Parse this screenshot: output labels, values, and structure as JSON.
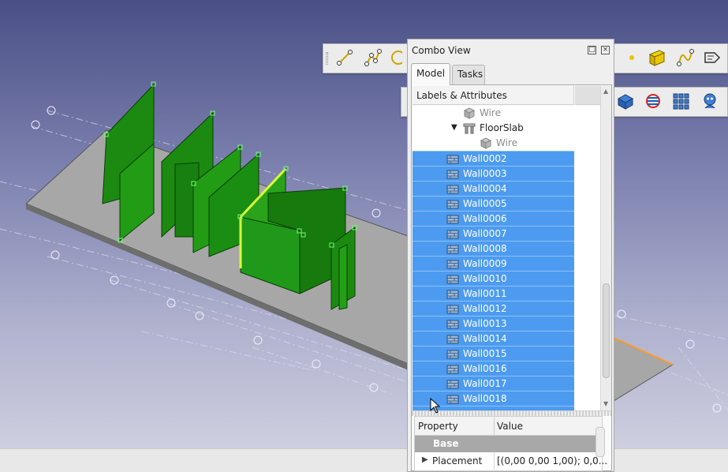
{
  "combo_view": {
    "title": "Combo View",
    "tabs": [
      {
        "label": "Model",
        "active": true
      },
      {
        "label": "Tasks",
        "active": false
      }
    ]
  },
  "tree": {
    "header": "Labels & Attributes",
    "rows": [
      {
        "label": "Wire",
        "type": "wire",
        "selected": false,
        "dim": true
      },
      {
        "label": "FloorSlab",
        "type": "structure",
        "selected": false,
        "dim": false,
        "expanded": true
      },
      {
        "label": "Wire",
        "type": "wire",
        "selected": false,
        "dim": true
      },
      {
        "label": "Wall0002",
        "type": "wall",
        "selected": true
      },
      {
        "label": "Wall0003",
        "type": "wall",
        "selected": true
      },
      {
        "label": "Wall0004",
        "type": "wall",
        "selected": true
      },
      {
        "label": "Wall0005",
        "type": "wall",
        "selected": true
      },
      {
        "label": "Wall0006",
        "type": "wall",
        "selected": true
      },
      {
        "label": "Wall0007",
        "type": "wall",
        "selected": true
      },
      {
        "label": "Wall0008",
        "type": "wall",
        "selected": true
      },
      {
        "label": "Wall0009",
        "type": "wall",
        "selected": true
      },
      {
        "label": "Wall0010",
        "type": "wall",
        "selected": true
      },
      {
        "label": "Wall0011",
        "type": "wall",
        "selected": true
      },
      {
        "label": "Wall0012",
        "type": "wall",
        "selected": true
      },
      {
        "label": "Wall0013",
        "type": "wall",
        "selected": true
      },
      {
        "label": "Wall0014",
        "type": "wall",
        "selected": true
      },
      {
        "label": "Wall0015",
        "type": "wall",
        "selected": true
      },
      {
        "label": "Wall0016",
        "type": "wall",
        "selected": true
      },
      {
        "label": "Wall0017",
        "type": "wall",
        "selected": true
      },
      {
        "label": "Wall0018",
        "type": "wall",
        "selected": true
      }
    ]
  },
  "properties": {
    "col_property": "Property",
    "col_value": "Value",
    "group": "Base",
    "rows": [
      {
        "name": "Placement",
        "value": "[(0,00 0,00 1,00); 0,0..."
      }
    ]
  },
  "colors": {
    "selection": "#4c9bf0",
    "wall_green": "#1f8f12",
    "slab_gray": "#9a9c9a",
    "highlight_yellow": "#d8ff3a"
  }
}
